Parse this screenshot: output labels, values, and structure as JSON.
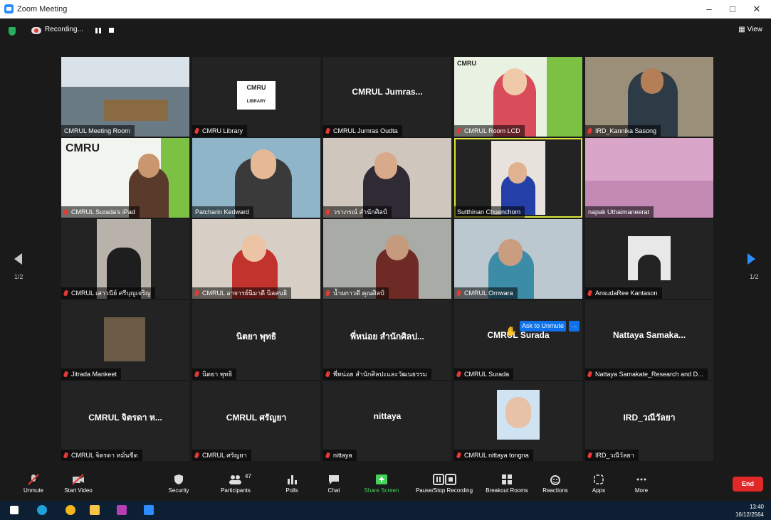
{
  "window": {
    "title": "Zoom Meeting",
    "min": "–",
    "max": "□",
    "close": "✕"
  },
  "topbar": {
    "recording_label": "Recording...",
    "view_label": "View"
  },
  "nav": {
    "prev_page": "1/2",
    "next_page": "1/2"
  },
  "tiles": [
    {
      "big": "",
      "name": "CMRUL Meeting Room"
    },
    {
      "big": "",
      "name": "CMRU Library"
    },
    {
      "big": "CMRUL Jumras...",
      "name": "CMRUL Jumras Oudta"
    },
    {
      "big": "",
      "name": "CMRUL Room LCD"
    },
    {
      "big": "",
      "name": "IRD_Kannika Sasong"
    },
    {
      "big": "",
      "name": "CMRUL Surada's iPad"
    },
    {
      "big": "",
      "name": "Patcharin Kedward"
    },
    {
      "big": "",
      "name": "วราภรณ์ สำนักศิลป์"
    },
    {
      "big": "",
      "name": "Sutthinan Chuenchom"
    },
    {
      "big": "",
      "name": "napak Uthaimaneerat"
    },
    {
      "big": "",
      "name": "CMRUL เสาวนีย์ ศรีบุญเจริญ"
    },
    {
      "big": "",
      "name": "CMRUL อาจารย์นิมาดี นิลสนธิ"
    },
    {
      "big": "",
      "name": "น้ำผกาวดี คุณศิลป์"
    },
    {
      "big": "",
      "name": "CMRUL Ornwara"
    },
    {
      "big": "",
      "name": "AnsudaRee Kantason"
    },
    {
      "big": "",
      "name": "Jitrada Mankeet"
    },
    {
      "big": "นิตยา พุทธิ",
      "name": "นิตยา พุทธิ"
    },
    {
      "big": "พี่หน่อย สำนักศิลป...",
      "name": "พี่หน่อย สำนักศิลปะและวัฒนธรรม"
    },
    {
      "big": "CMRUL Surada",
      "name": "CMRUL Surada"
    },
    {
      "big": "Nattaya Samaka...",
      "name": "Nattaya Samakate_Research and D..."
    },
    {
      "big": "CMRUL จิตรดา ห...",
      "name": "CMRUL จิตรดา หมั่นขีด"
    },
    {
      "big": "CMRUL ศรัญยา",
      "name": "CMRUL ศรัญยา"
    },
    {
      "big": "nittaya",
      "name": "nittaya"
    },
    {
      "big": "",
      "name": "CMRUL nittaya tongna"
    },
    {
      "big": "IRD_วณีวัลยา",
      "name": "IRD_วณีวัลยา"
    }
  ],
  "library_logo": {
    "line1": "CMRU",
    "line2": "LIBRARY"
  },
  "unmute_prompt": {
    "label": "Ask to Unmute",
    "more": "..."
  },
  "toolbar": {
    "unmute": "Unmute",
    "start_video": "Start Video",
    "security": "Security",
    "participants": "Participants",
    "participants_count": "47",
    "polls": "Polls",
    "chat": "Chat",
    "share": "Share Screen",
    "pause_rec": "Pause/Stop Recording",
    "breakout": "Breakout Rooms",
    "reactions": "Reactions",
    "apps": "Apps",
    "more": "More",
    "end": "End"
  },
  "taskbar": {
    "time": "13:40",
    "date": "16/12/2564"
  },
  "colors": {
    "accent": "#2d8cff",
    "end": "#e02828",
    "active_speaker": "#dbe53a",
    "share": "#45d15a"
  }
}
